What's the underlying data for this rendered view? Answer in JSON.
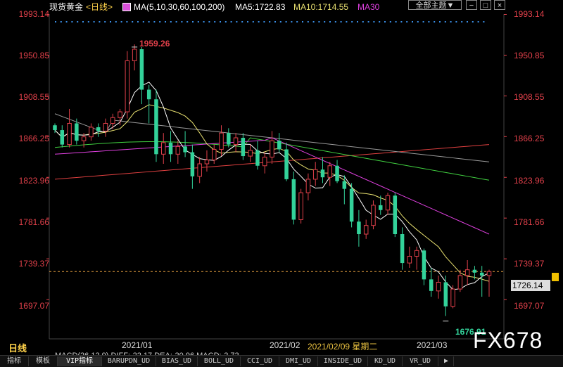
{
  "header": {
    "instrument": "现货黄金",
    "period": "<日线>",
    "ma_label": "MA(5,10,30,60,100,200)",
    "ma5": "MA5:1722.83",
    "ma10": "MA10:1714.55",
    "ma30": "MA30",
    "theme_select": "全部主题▼"
  },
  "price_axis": [
    "1993.14",
    "1950.85",
    "1908.55",
    "1866.25",
    "1823.96",
    "1781.66",
    "1739.37",
    "1697.07"
  ],
  "current_price": "1726.14",
  "high_label": "1959.26",
  "low_label": "1676.91",
  "x_labels": [
    "2021/01",
    "2021/02",
    "2021/02/09 星期二",
    "2021/03"
  ],
  "bottom_left": "日线",
  "indicator_text": "MACD(26,12,9) DIFF:-22.17 DEA:-20.96 MACD:-2.72",
  "watermark": "FX678",
  "tabs": [
    "指标",
    "模板",
    "VIP指标",
    "BARUPDN_UD",
    "BIAS_UD",
    "BOLL_UD",
    "CCI_UD",
    "DMI_UD",
    "INSIDE_UD",
    "KD_UD",
    "VR_UD"
  ],
  "colors": {
    "up": "#e0404a",
    "down": "#33d29a",
    "ma5": "#ffffff",
    "ma10": "#e8e070",
    "ma30": "#e040e0",
    "ma60": "#40d040",
    "ma100": "#9a9a9a",
    "ma200": "#e04040",
    "dotline": "#3a8ee6"
  },
  "chart_data": {
    "type": "candlestick",
    "ylim": [
      1676.91,
      1993.14
    ],
    "candles": [
      [
        1878,
        1880,
        1870,
        1873
      ],
      [
        1873,
        1878,
        1855,
        1858
      ],
      [
        1858,
        1895,
        1855,
        1880
      ],
      [
        1880,
        1885,
        1858,
        1862
      ],
      [
        1862,
        1870,
        1855,
        1866
      ],
      [
        1866,
        1880,
        1862,
        1876
      ],
      [
        1876,
        1880,
        1866,
        1872
      ],
      [
        1872,
        1885,
        1866,
        1880
      ],
      [
        1880,
        1890,
        1874,
        1886
      ],
      [
        1886,
        1895,
        1878,
        1892
      ],
      [
        1892,
        1955,
        1885,
        1945
      ],
      [
        1945,
        1962,
        1935,
        1957
      ],
      [
        1957,
        1959.26,
        1900,
        1915
      ],
      [
        1915,
        1920,
        1880,
        1905
      ],
      [
        1905,
        1915,
        1840,
        1848
      ],
      [
        1848,
        1870,
        1838,
        1860
      ],
      [
        1860,
        1872,
        1840,
        1848
      ],
      [
        1848,
        1862,
        1838,
        1856
      ],
      [
        1856,
        1872,
        1845,
        1850
      ],
      [
        1850,
        1858,
        1812,
        1825
      ],
      [
        1825,
        1845,
        1818,
        1838
      ],
      [
        1838,
        1852,
        1830,
        1842
      ],
      [
        1842,
        1858,
        1838,
        1853
      ],
      [
        1853,
        1878,
        1846,
        1870
      ],
      [
        1870,
        1875,
        1855,
        1858
      ],
      [
        1858,
        1870,
        1850,
        1865
      ],
      [
        1865,
        1870,
        1842,
        1846
      ],
      [
        1846,
        1858,
        1840,
        1852
      ],
      [
        1852,
        1862,
        1832,
        1836
      ],
      [
        1836,
        1850,
        1828,
        1845
      ],
      [
        1845,
        1872,
        1838,
        1862
      ],
      [
        1862,
        1870,
        1850,
        1853
      ],
      [
        1853,
        1860,
        1820,
        1822
      ],
      [
        1822,
        1830,
        1775,
        1780
      ],
      [
        1780,
        1812,
        1776,
        1808
      ],
      [
        1808,
        1828,
        1800,
        1822
      ],
      [
        1822,
        1840,
        1815,
        1832
      ],
      [
        1832,
        1845,
        1818,
        1824
      ],
      [
        1824,
        1840,
        1815,
        1836
      ],
      [
        1836,
        1842,
        1818,
        1820
      ],
      [
        1820,
        1826,
        1796,
        1812
      ],
      [
        1812,
        1818,
        1772,
        1778
      ],
      [
        1778,
        1790,
        1752,
        1765
      ],
      [
        1765,
        1780,
        1760,
        1774
      ],
      [
        1774,
        1800,
        1770,
        1795
      ],
      [
        1795,
        1805,
        1785,
        1790
      ],
      [
        1790,
        1808,
        1785,
        1805
      ],
      [
        1805,
        1808,
        1762,
        1765
      ],
      [
        1765,
        1772,
        1728,
        1735
      ],
      [
        1735,
        1752,
        1730,
        1742
      ],
      [
        1742,
        1752,
        1728,
        1748
      ],
      [
        1748,
        1750,
        1712,
        1718
      ],
      [
        1718,
        1730,
        1700,
        1706
      ],
      [
        1706,
        1722,
        1698,
        1715
      ],
      [
        1715,
        1722,
        1680,
        1690
      ],
      [
        1690,
        1712,
        1688,
        1708
      ],
      [
        1708,
        1728,
        1705,
        1722
      ],
      [
        1722,
        1738,
        1712,
        1728
      ],
      [
        1728,
        1732,
        1718,
        1725
      ],
      [
        1725,
        1732,
        1700,
        1722
      ],
      [
        1722,
        1728,
        1700,
        1726.14
      ]
    ]
  }
}
